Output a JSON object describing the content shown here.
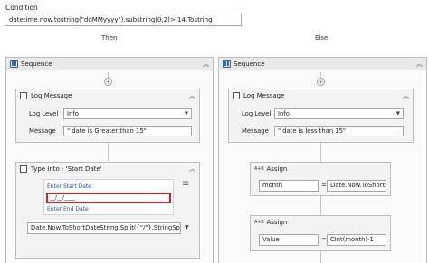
{
  "condition": {
    "label": "Condition",
    "value": "datetime.now.tostring(\"ddMMyyyy\").substring(0,2)> 14.Tostring"
  },
  "branches": {
    "then_label": "Then",
    "else_label": "Else"
  },
  "then": {
    "sequence_title": "Sequence",
    "log_message": {
      "title": "Log Message",
      "level_label": "Log Level",
      "level_value": "Info",
      "message_label": "Message",
      "message_value": "\" date is Greater than 15\""
    },
    "type_into": {
      "title": "Type Into - 'Start Date'",
      "screenshot_top_label": "Enter Start Date",
      "screenshot_field_text": "__/__/____",
      "screenshot_bottom_label": "Enter End Date",
      "text_value": "Date.Now.ToShortDateString.Split({\"/\"},StringSplitOp"
    }
  },
  "else": {
    "sequence_title": "Sequence",
    "log_message": {
      "title": "Log Message",
      "level_label": "Log Level",
      "level_value": "Info",
      "message_label": "Message",
      "message_value": "\" date is less than 15\""
    },
    "assign1": {
      "title": "Assign",
      "badge": "A+B",
      "to": "month",
      "value": "Date.Now.ToShortI"
    },
    "assign2": {
      "title": "Assign",
      "badge": "A+B",
      "to": "Value",
      "value": "CInt(month)-1"
    }
  },
  "symbols": {
    "equals": "=",
    "collapse": "︽",
    "plus": "+",
    "dropdown": "▼",
    "menu": "≡"
  },
  "colors": {
    "selection_red": "#c0282a",
    "link_blue": "#1f4fb5",
    "sequence_blue": "#2a6ebb"
  }
}
